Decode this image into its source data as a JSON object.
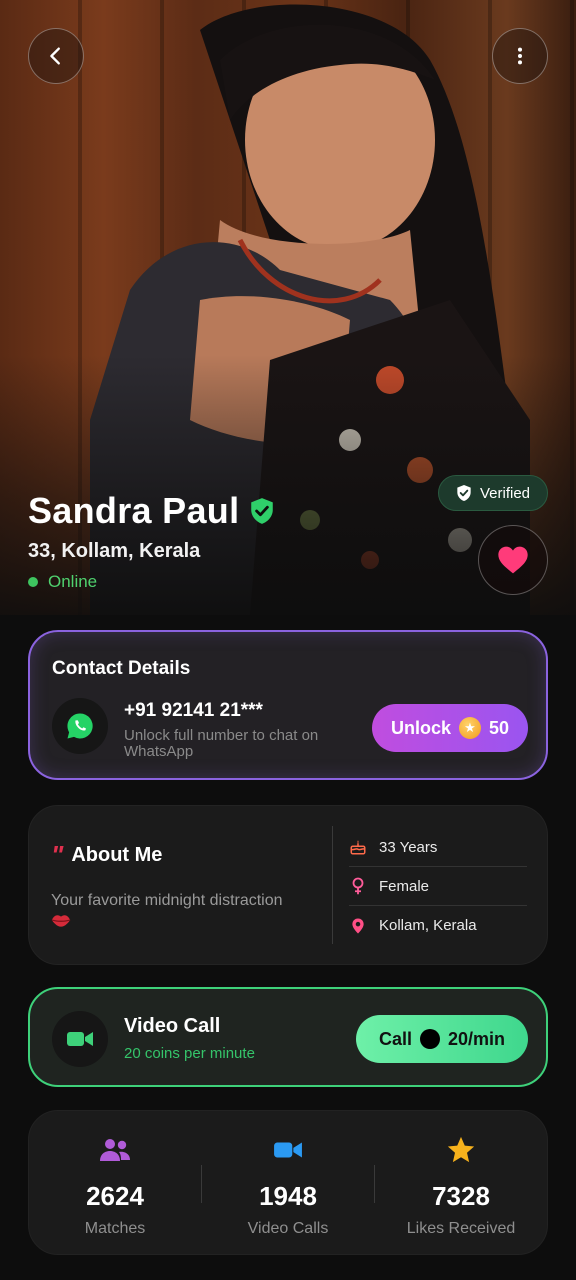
{
  "profile": {
    "name": "Sandra Paul",
    "location_line": "33, Kollam, Kerala",
    "status": "Online",
    "verified_label": "Verified"
  },
  "contact": {
    "title": "Contact Details",
    "phone": "+91 92141 21***",
    "hint": "Unlock full number to chat on WhatsApp",
    "unlock_label": "Unlock",
    "unlock_cost": "50"
  },
  "about": {
    "title": "About Me",
    "bio": "Your favorite midnight distraction",
    "facts": [
      {
        "icon": "cake-icon",
        "label": "33 Years"
      },
      {
        "icon": "female-icon",
        "label": "Female"
      },
      {
        "icon": "location-pin-icon",
        "label": "Kollam, Kerala"
      }
    ]
  },
  "video_call": {
    "title": "Video Call",
    "subtitle": "20 coins per minute",
    "button_label": "Call",
    "rate": "20/min"
  },
  "stats": [
    {
      "icon": "people-icon",
      "value": "2624",
      "label": "Matches"
    },
    {
      "icon": "video-camera-icon",
      "value": "1948",
      "label": "Video Calls"
    },
    {
      "icon": "star-icon",
      "value": "7328",
      "label": "Likes Received"
    }
  ],
  "colors": {
    "accent_purple": "#8b63e0",
    "accent_green": "#3ed17a",
    "online_green": "#3ec45f",
    "heart_pink": "#ff3b7a",
    "quote_red": "#e0304e"
  }
}
